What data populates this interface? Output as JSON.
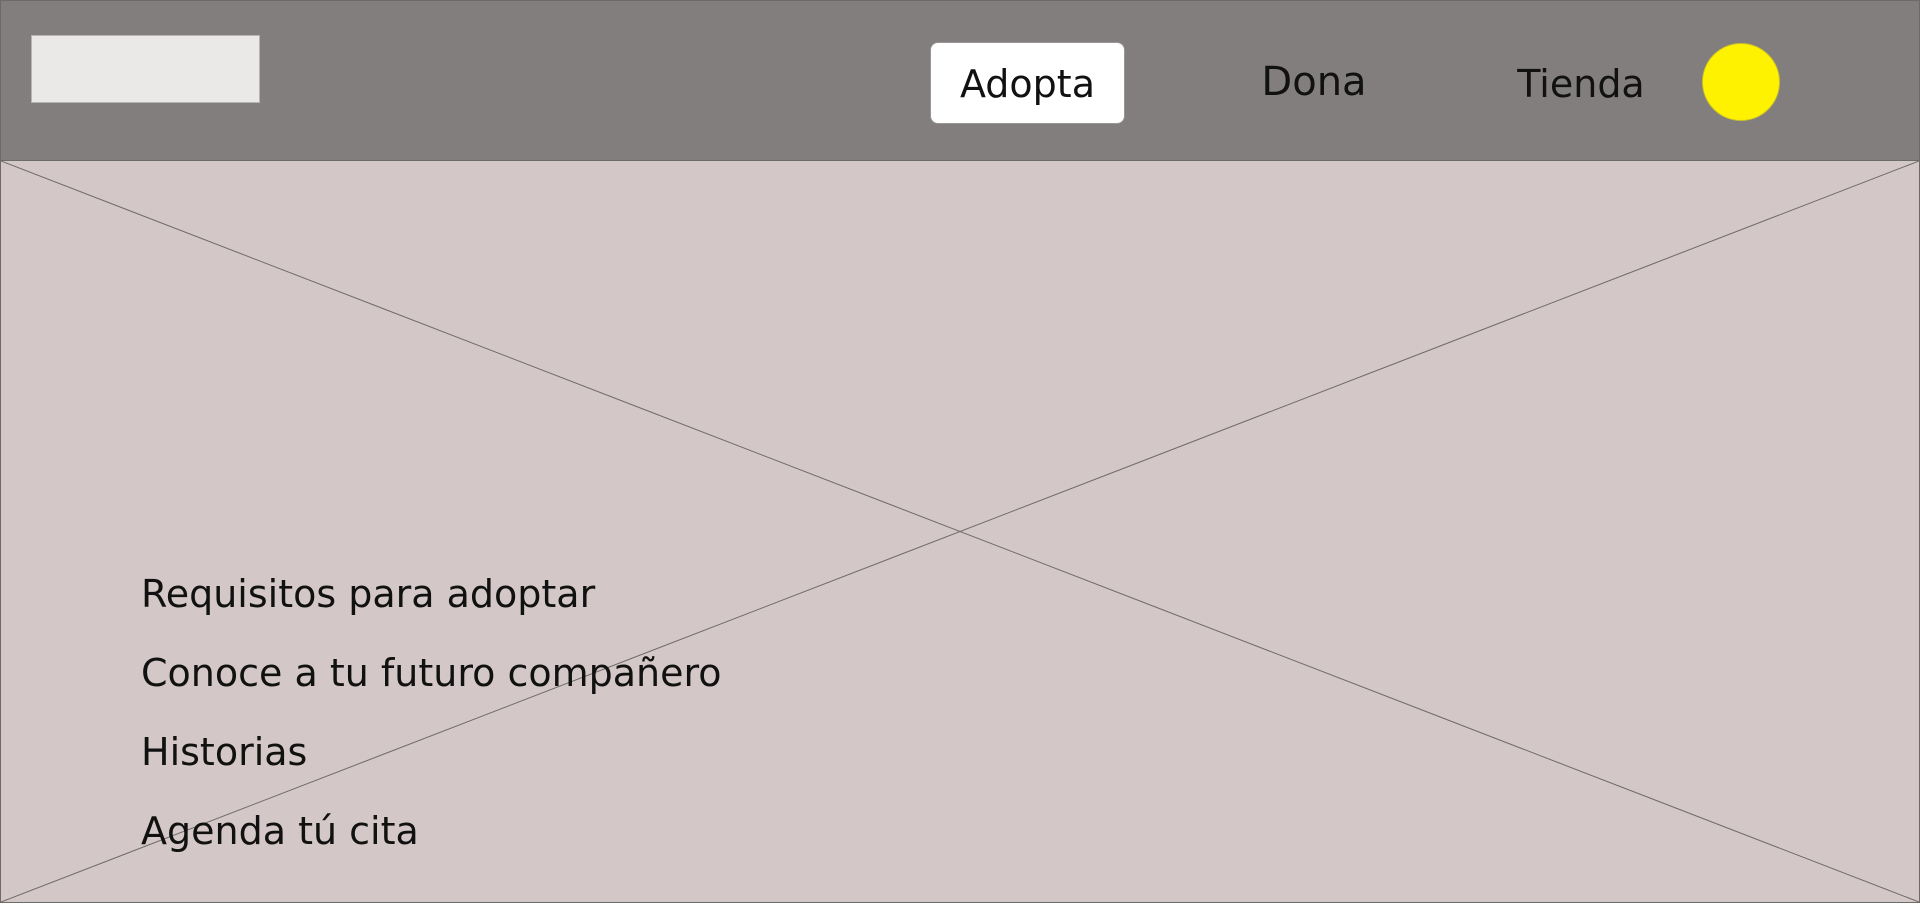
{
  "header": {
    "nav": {
      "adopta": "Adopta",
      "dona": "Dona",
      "tienda": "Tienda"
    },
    "avatar_color": "#fff200"
  },
  "hero": {
    "links": [
      "Requisitos para adoptar",
      "Conoce a tu futuro compañero",
      "Historias",
      "Agenda tú cita"
    ]
  },
  "colors": {
    "header_background": "#827e7d",
    "hero_background": "#d3c8c7",
    "active_nav_background": "#ffffff"
  }
}
